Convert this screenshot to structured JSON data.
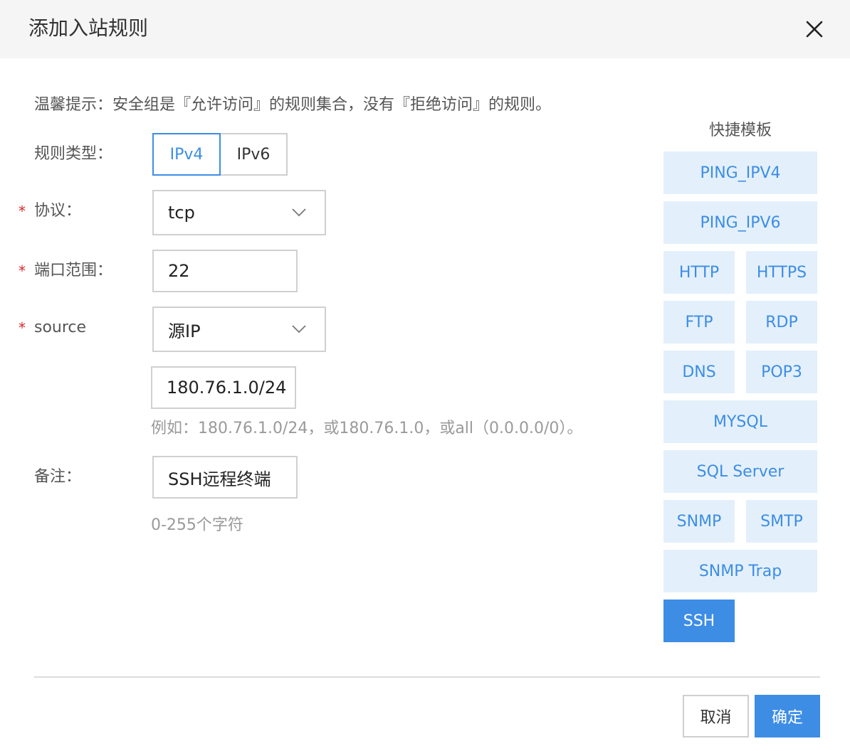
{
  "dialog": {
    "title": "添加入站规则",
    "hint": "温馨提示：安全组是『允许访问』的规则集合，没有『拒绝访问』的规则。"
  },
  "form": {
    "required_mark": "*",
    "rule_type": {
      "label": "规则类型：",
      "options": [
        "IPv4",
        "IPv6"
      ],
      "selected": "IPv4"
    },
    "protocol": {
      "label": "协议：",
      "value": "tcp"
    },
    "port": {
      "label": "端口范围：",
      "value": "22"
    },
    "source": {
      "label": "source",
      "type_value": "源IP",
      "cidr_value": "180.76.1.0/24",
      "help": "例如：180.76.1.0/24，或180.76.1.0，或all（0.0.0.0/0）。"
    },
    "remark": {
      "label": "备注：",
      "value": "SSH远程终端",
      "help": "0-255个字符"
    }
  },
  "templates": {
    "title": "快捷模板",
    "items": [
      "PING_IPV4",
      "PING_IPV6",
      "HTTP",
      "HTTPS",
      "FTP",
      "RDP",
      "DNS",
      "POP3",
      "MYSQL",
      "SQL Server",
      "SNMP",
      "SMTP",
      "SNMP Trap",
      "SSH"
    ],
    "selected": "SSH"
  },
  "footer": {
    "cancel": "取消",
    "confirm": "确定"
  },
  "colors": {
    "accent": "#3d8de5",
    "template_bg": "#e3f0fb",
    "required": "#d9262c"
  },
  "icons": {
    "close": "close-icon",
    "dropdown": "chevron-down-icon"
  }
}
